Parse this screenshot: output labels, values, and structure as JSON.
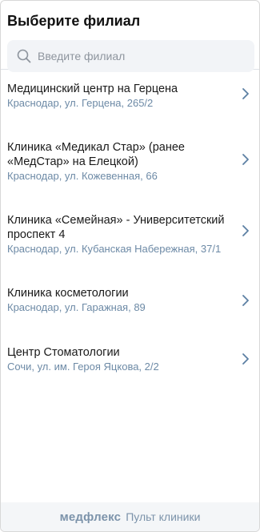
{
  "header": {
    "title": "Выберите филиал"
  },
  "search": {
    "placeholder": "Введите филиал",
    "icon": "search-icon"
  },
  "branches": [
    {
      "name": "Медицинский центр на Герцена",
      "address": "Краснодар, ул. Герцена, 265/2"
    },
    {
      "name": "Клиника «Медикал Стар» (ранее «МедСтар» на Елецкой)",
      "address": "Краснодар, ул. Кожевенная, 66"
    },
    {
      "name": "Клиника «Семейная» - Университетский проспект 4",
      "address": "Краснодар, ул. Кубанская Набережная, 37/1"
    },
    {
      "name": "Клиника косметологии",
      "address": "Краснодар, ул. Гаражная, 89"
    },
    {
      "name": "Центр Стоматологии",
      "address": "Сочи, ул. им. Героя Яцкова, 2/2"
    }
  ],
  "footer": {
    "brand": "медфлекс",
    "subtitle": "Пульт клиники"
  },
  "colors": {
    "address": "#6d8aa6",
    "chevron": "#5b7fa3",
    "footer_bg": "#f4f6f8",
    "footer_text": "#7c93aa"
  }
}
